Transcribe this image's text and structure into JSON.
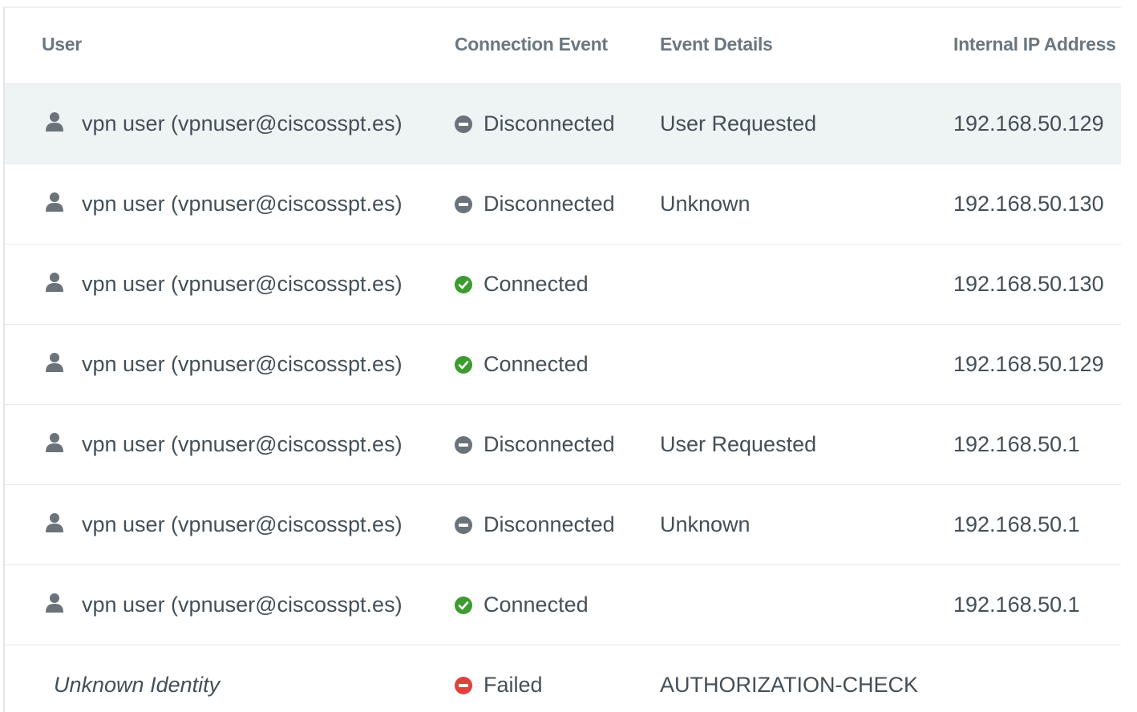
{
  "table": {
    "columns": {
      "user": "User",
      "connection_event": "Connection Event",
      "event_details": "Event Details",
      "internal_ip": "Internal IP Address"
    },
    "rows": [
      {
        "user": "vpn user (vpnuser@ciscosspt.es)",
        "event": "Disconnected",
        "status": "disconnected",
        "details": "User Requested",
        "ip": "192.168.50.129"
      },
      {
        "user": "vpn user (vpnuser@ciscosspt.es)",
        "event": "Disconnected",
        "status": "disconnected",
        "details": "Unknown",
        "ip": "192.168.50.130"
      },
      {
        "user": "vpn user (vpnuser@ciscosspt.es)",
        "event": "Connected",
        "status": "connected",
        "details": "",
        "ip": "192.168.50.130"
      },
      {
        "user": "vpn user (vpnuser@ciscosspt.es)",
        "event": "Connected",
        "status": "connected",
        "details": "",
        "ip": "192.168.50.129"
      },
      {
        "user": "vpn user (vpnuser@ciscosspt.es)",
        "event": "Disconnected",
        "status": "disconnected",
        "details": "User Requested",
        "ip": "192.168.50.1"
      },
      {
        "user": "vpn user (vpnuser@ciscosspt.es)",
        "event": "Disconnected",
        "status": "disconnected",
        "details": "Unknown",
        "ip": "192.168.50.1"
      },
      {
        "user": "vpn user (vpnuser@ciscosspt.es)",
        "event": "Connected",
        "status": "connected",
        "details": "",
        "ip": "192.168.50.1"
      },
      {
        "user": "Unknown Identity",
        "event": "Failed",
        "status": "failed",
        "details": "AUTHORIZATION-CHECK",
        "ip": "",
        "unknown_identity": true
      }
    ]
  },
  "icons": {
    "user": "user-icon",
    "connected": "check-circle-icon",
    "disconnected": "minus-circle-icon",
    "failed": "minus-circle-icon"
  },
  "colors": {
    "connected": "#3d9b2f",
    "disconnected": "#6a737a",
    "failed": "#e2403b",
    "row_hover": "#eef3f4"
  }
}
